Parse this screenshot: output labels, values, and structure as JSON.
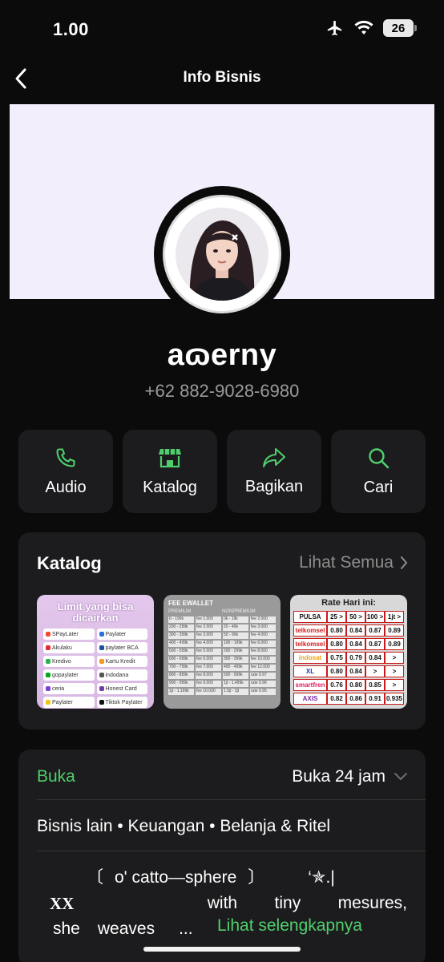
{
  "status_bar": {
    "time": "1.00",
    "battery": "26"
  },
  "header": {
    "title": "Info Bisnis"
  },
  "profile": {
    "name": "aɷerny",
    "phone": "+62 882-9028-6980"
  },
  "actions": [
    {
      "label": "Audio",
      "icon": "phone-icon"
    },
    {
      "label": "Katalog",
      "icon": "storefront-icon"
    },
    {
      "label": "Bagikan",
      "icon": "share-arrow-icon"
    },
    {
      "label": "Cari",
      "icon": "search-icon"
    }
  ],
  "catalog": {
    "title": "Katalog",
    "see_all": "Lihat Semua",
    "items": [
      {
        "title": "Limit yang bisa dicairkan",
        "entries": [
          "SPayLater",
          "Paylater",
          "Akulaku",
          "paylater BCA",
          "Kredivo",
          "Kartu Kredit",
          "gopaylater",
          "indodana",
          "ceria",
          "Honest Card",
          "Paylater",
          "Tiktok Paylater"
        ]
      },
      {
        "title": "FEE EWALLET",
        "columns": [
          "PREMIUM",
          "NONPREMIUM"
        ],
        "rows": [
          [
            "0 - 199k",
            "fee 1.000",
            "0k - 19k",
            "fee 2.000"
          ],
          [
            "200 - 299k",
            "fee 2.000",
            "20 - 49k",
            "fee 3.000"
          ],
          [
            "300 - 399k",
            "fee 3.000",
            "50 - 99k",
            "fee 4.000"
          ],
          [
            "400 - 499k",
            "fee 4.000",
            "100 - 199k",
            "fee 6.000"
          ],
          [
            "500 - 599k",
            "fee 5.000",
            "200 - 299k",
            "fee 8.000"
          ],
          [
            "600 - 699k",
            "fee 6.000",
            "300 - 399k",
            "fee 10.000"
          ],
          [
            "700 - 799k",
            "fee 7.000",
            "400 - 499k",
            "fee 12.000"
          ],
          [
            "800 - 899k",
            "fee 8.000",
            "500 - 999k",
            "rate 0.97"
          ],
          [
            "900 - 999k",
            "fee 9.000",
            "1jt - 1.499k",
            "rate 0.96"
          ],
          [
            "1jt - 1.199k",
            "fee 10.000",
            "1.5jt - 2jt",
            "rate 0.95"
          ]
        ]
      },
      {
        "title": "Rate Hari ini:",
        "header_row": [
          "PULSA",
          "25 >",
          "50 >",
          "100 >",
          "1jt >"
        ],
        "rows": [
          [
            "telkomsel",
            "0.80",
            "0.84",
            "0.87",
            "0.89"
          ],
          [
            "telkomsel",
            "0.80",
            "0.84",
            "0.87",
            "0.89"
          ],
          [
            "indosat",
            "0.75",
            "0.79",
            "0.84",
            ">"
          ],
          [
            "XL",
            "0.80",
            "0.84",
            ">",
            ">"
          ],
          [
            "smartfren",
            "0.76",
            "0.80",
            "0.85",
            ">"
          ],
          [
            "AXIS",
            "0.82",
            "0.86",
            "0.91",
            "0.935"
          ]
        ]
      }
    ]
  },
  "business": {
    "status": "Buka",
    "hours": "Buka 24 jam",
    "categories": "Bisnis lain • Keuangan • Belanja & Ritel",
    "description_lines": [
      [
        "〔",
        "o' catto—sphere",
        "〕",
        "‘✯.|"
      ],
      [
        "XX",
        "with",
        "tiny",
        "mesures,"
      ],
      [
        "she",
        "weaves",
        "..."
      ]
    ],
    "see_more": "Lihat selengkapnya"
  },
  "colors": {
    "accent": "#4fcf6c",
    "card_bg": "#1c1c1e",
    "page_bg": "#0b0b0b",
    "cover_bg": "#f3eefb"
  }
}
